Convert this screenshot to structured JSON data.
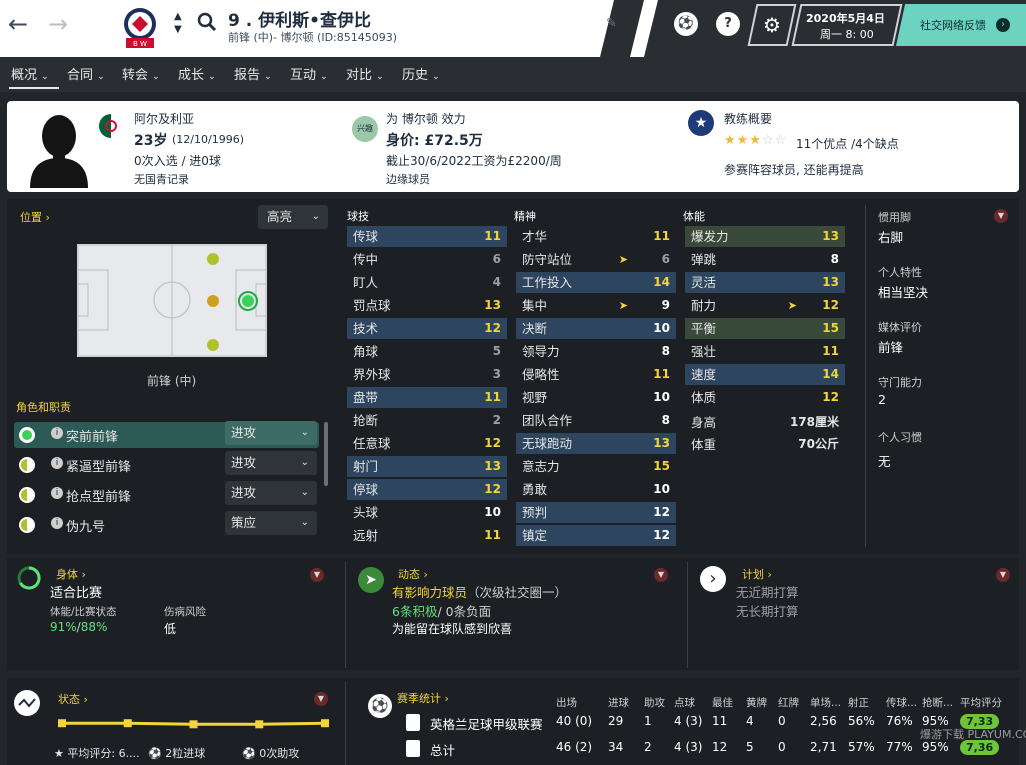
{
  "header": {
    "player_title": "9 . 伊利斯•查伊比",
    "player_subtitle": "前锋 (中)- 博尔顿 (ID:85145093)",
    "date_line1": "2020年5月4日",
    "date_line2": "周一 8: 00",
    "feedback_label": "社交网络反馈",
    "help_label": "?"
  },
  "menu": [
    "概况",
    "合同",
    "转会",
    "成长",
    "报告",
    "互动",
    "对比",
    "历史"
  ],
  "info": {
    "nationality": "阿尔及利亚",
    "age": "23岁",
    "dob": "(12/10/1996)",
    "caps": "0次入选 / 进0球",
    "youth": "无国青记录",
    "club_line": "为 博尔顿 效力",
    "value": "身价: £72.5万",
    "contract": "截止30/6/2022工资为£2200/周",
    "squad_status": "边缘球员",
    "interest_badge": "兴趣",
    "coach_title": "教练概要",
    "strengths": "11个优点 /4个缺点",
    "coach_summary": "参赛阵容球员, 还能再提高",
    "stars": 2.5
  },
  "position": {
    "title": "位置",
    "dropdown": "高亮",
    "label": "前锋 (中)"
  },
  "roles": {
    "title": "角色和职责",
    "items": [
      {
        "name": "突前前锋",
        "duty": "进攻"
      },
      {
        "name": "紧逼型前锋",
        "duty": "进攻"
      },
      {
        "name": "抢点型前锋",
        "duty": "进攻"
      },
      {
        "name": "伪九号",
        "duty": "策应"
      }
    ]
  },
  "attributes": {
    "technical_title": "球技",
    "mental_title": "精神",
    "physical_title": "体能",
    "technical": [
      {
        "n": "传球",
        "v": "11"
      },
      {
        "n": "传中",
        "v": "6"
      },
      {
        "n": "盯人",
        "v": "4"
      },
      {
        "n": "罚点球",
        "v": "13"
      },
      {
        "n": "技术",
        "v": "12"
      },
      {
        "n": "角球",
        "v": "5"
      },
      {
        "n": "界外球",
        "v": "3"
      },
      {
        "n": "盘带",
        "v": "11"
      },
      {
        "n": "抢断",
        "v": "2"
      },
      {
        "n": "任意球",
        "v": "12"
      },
      {
        "n": "射门",
        "v": "13"
      },
      {
        "n": "停球",
        "v": "12"
      },
      {
        "n": "头球",
        "v": "10"
      },
      {
        "n": "远射",
        "v": "11"
      }
    ],
    "mental": [
      {
        "n": "才华",
        "v": "11"
      },
      {
        "n": "防守站位",
        "v": "6"
      },
      {
        "n": "工作投入",
        "v": "14"
      },
      {
        "n": "集中",
        "v": "9"
      },
      {
        "n": "决断",
        "v": "10"
      },
      {
        "n": "领导力",
        "v": "8"
      },
      {
        "n": "侵略性",
        "v": "11"
      },
      {
        "n": "视野",
        "v": "10"
      },
      {
        "n": "团队合作",
        "v": "8"
      },
      {
        "n": "无球跑动",
        "v": "13"
      },
      {
        "n": "意志力",
        "v": "15"
      },
      {
        "n": "勇敢",
        "v": "10"
      },
      {
        "n": "预判",
        "v": "12"
      },
      {
        "n": "镇定",
        "v": "12"
      }
    ],
    "physical": [
      {
        "n": "爆发力",
        "v": "13"
      },
      {
        "n": "弹跳",
        "v": "8"
      },
      {
        "n": "灵活",
        "v": "13"
      },
      {
        "n": "耐力",
        "v": "12"
      },
      {
        "n": "平衡",
        "v": "15"
      },
      {
        "n": "强壮",
        "v": "11"
      },
      {
        "n": "速度",
        "v": "14"
      },
      {
        "n": "体质",
        "v": "12"
      }
    ],
    "height_label": "身高",
    "height": "178厘米",
    "weight_label": "体重",
    "weight": "70公斤"
  },
  "sidebar": {
    "foot_label": "惯用脚",
    "foot": "右脚",
    "trait_label": "个人特性",
    "trait": "相当坚决",
    "media_label": "媒体评价",
    "media": "前锋",
    "def_label": "守门能力",
    "def": "2",
    "habit_label": "个人习惯",
    "habit": "无"
  },
  "body": {
    "title": "身体",
    "status": "适合比赛",
    "fitness_label": "体能/比赛状态",
    "fitness_a": "91%",
    "fitness_b": "88%",
    "injury_label": "伤病风险",
    "injury": "低"
  },
  "dynamics": {
    "title": "动态",
    "role": "有影响力球员",
    "group": "（次级社交圈一）",
    "positives": "6条积极",
    "negatives": "/ 0条负面",
    "note": "为能留在球队感到欣喜"
  },
  "plan": {
    "title": "计划",
    "short": "无近期打算",
    "long": "无长期打算"
  },
  "form": {
    "title": "状态",
    "avg_rating": "平均评分: 6....",
    "goals": "2粒进球",
    "assists": "0次助攻",
    "values": [
      0.88,
      0.88,
      0.87,
      0.87,
      0.88
    ]
  },
  "season": {
    "title": "赛季统计",
    "headers": [
      "出场",
      "进球",
      "助攻",
      "点球",
      "最佳",
      "黄牌",
      "红牌",
      "单场...",
      "射正",
      "传球...",
      "抢断...",
      "平均评分"
    ],
    "rows": [
      {
        "comp": "英格兰足球甲级联赛",
        "cells": [
          "40 (0)",
          "29",
          "1",
          "4 (3)",
          "11",
          "4",
          "0",
          "2,56",
          "56%",
          "76%",
          "95%",
          "7,33"
        ]
      },
      {
        "comp": "总计",
        "cells": [
          "46 (2)",
          "34",
          "2",
          "4 (3)",
          "12",
          "5",
          "0",
          "2,71",
          "57%",
          "77%",
          "95%",
          "7,36"
        ]
      }
    ]
  },
  "watermark": "爆游下载 PLAYUM.CC"
}
